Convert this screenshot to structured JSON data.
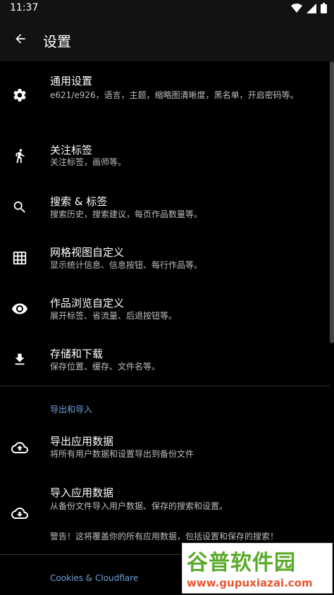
{
  "status_bar": {
    "time": "11:37"
  },
  "app_bar": {
    "title": "设置"
  },
  "items": [
    {
      "icon": "gear-icon",
      "title": "通用设置",
      "subtitle": "e621/e926，语言，主题，缩略图清晰度，黑名单，开启密码等。"
    },
    {
      "icon": "walk-icon",
      "title": "关注标签",
      "subtitle": "关注标签，画师等。"
    },
    {
      "icon": "search-icon",
      "title": "搜索 & 标签",
      "subtitle": "搜索历史，搜索建议，每页作品数量等。"
    },
    {
      "icon": "grid-icon",
      "title": "网格视图自定义",
      "subtitle": "显示统计信息、信息按钮、每行作品等。"
    },
    {
      "icon": "eye-icon",
      "title": "作品浏览自定义",
      "subtitle": "展开标签、省流量、后退按钮等。"
    },
    {
      "icon": "download-icon",
      "title": "存储和下载",
      "subtitle": "保存位置、缓存、文件名等。"
    }
  ],
  "section_export": {
    "header": "导出和导入",
    "export": {
      "icon": "cloud-upload-icon",
      "title": "导出应用数据",
      "subtitle": "将所有用户数据和设置导出到备份文件"
    },
    "import": {
      "icon": "cloud-download-icon",
      "title": "导入应用数据",
      "subtitle": "从备份文件导入用户数据、保存的搜索和设置。",
      "warning": "警告！这将覆盖你的所有应用数据，包括设置和保存的搜索！"
    }
  },
  "section_cloudflare": {
    "header": "Cookies & Cloudflare"
  },
  "watermark": {
    "big": "谷普软件园",
    "small": "www.gupuxiazai.com"
  },
  "colors": {
    "background": "#000000",
    "bar": "#121212",
    "accent": "#6ea0d8",
    "subtext": "#bdbdbd"
  }
}
